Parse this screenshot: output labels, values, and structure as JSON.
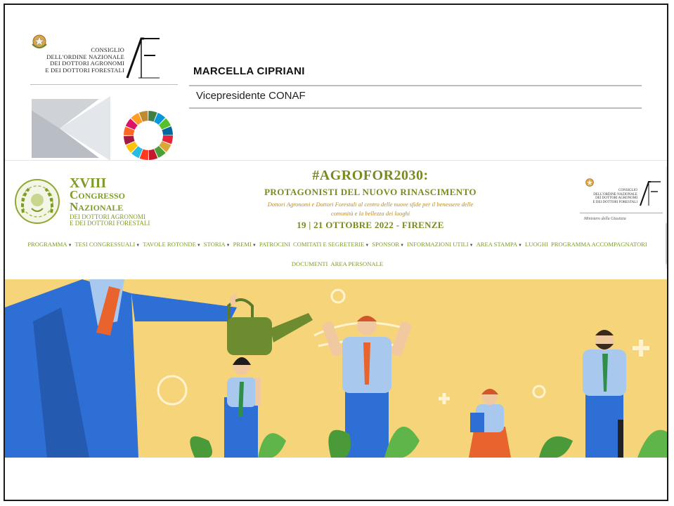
{
  "slide": {
    "logo_org_lines": [
      "CONSIGLIO",
      "DELL'ORDINE NAZIONALE",
      "DEI DOTTORI AGRONOMI",
      "E DEI DOTTORI FORESTALI"
    ],
    "speaker_name": "MARCELLA CIPRIANI",
    "speaker_role": "Vicepresidente CONAF"
  },
  "website": {
    "congress_logo": {
      "line1": "XVIII",
      "line2": "Congresso",
      "line3": "Nazionale",
      "line4": "DEI DOTTORI AGRONOMI",
      "line5": "E DEI DOTTORI FORESTALI"
    },
    "event": {
      "title": "#AGROFOR2030:",
      "subtitle": "PROTAGONISTI DEL NUOVO RINASCIMENTO",
      "description_line1": "Dottori Agronomi e Dottori Forestali al centro delle nuove sfide per il benessere delle",
      "description_line2": "comunità e la bellezza dei luoghi",
      "date": "19 | 21 OTTOBRE 2022 - FIRENZE"
    },
    "conaf_small": {
      "org_lines": [
        "CONSIGLIO",
        "DELL'ORDINE NAZIONALE",
        "DEI DOTTORI AGRONOMI",
        "E DEI DOTTORI FORESTALI"
      ],
      "ministry": "Ministero della Giustizia"
    },
    "nav_row1": [
      {
        "label": "PROGRAMMA",
        "caret": true
      },
      {
        "label": "TESI CONGRESSUALI",
        "caret": true
      },
      {
        "label": "TAVOLE ROTONDE",
        "caret": true
      },
      {
        "label": "STORIA",
        "caret": true
      },
      {
        "label": "PREMI",
        "caret": true
      },
      {
        "label": "PATROCINI",
        "caret": false
      },
      {
        "label": "COMITATI E SEGRETERIE",
        "caret": true
      },
      {
        "label": "SPONSOR",
        "caret": true
      },
      {
        "label": "INFORMAZIONI UTILI",
        "caret": true
      },
      {
        "label": "AREA STAMPA",
        "caret": true
      },
      {
        "label": "LUOGHI",
        "caret": false
      },
      {
        "label": "PROGRAMMA ACCOMPAGNATORI",
        "caret": false
      }
    ],
    "nav_row2": [
      {
        "label": "DOCUMENTI",
        "caret": false
      },
      {
        "label": "AREA PERSONALE",
        "caret": false
      }
    ]
  },
  "colors": {
    "accent_green": "#7f9b2a",
    "hero_background": "#f6d47a",
    "jacket_blue": "#2e6fd6",
    "tie_orange": "#e8642c"
  }
}
